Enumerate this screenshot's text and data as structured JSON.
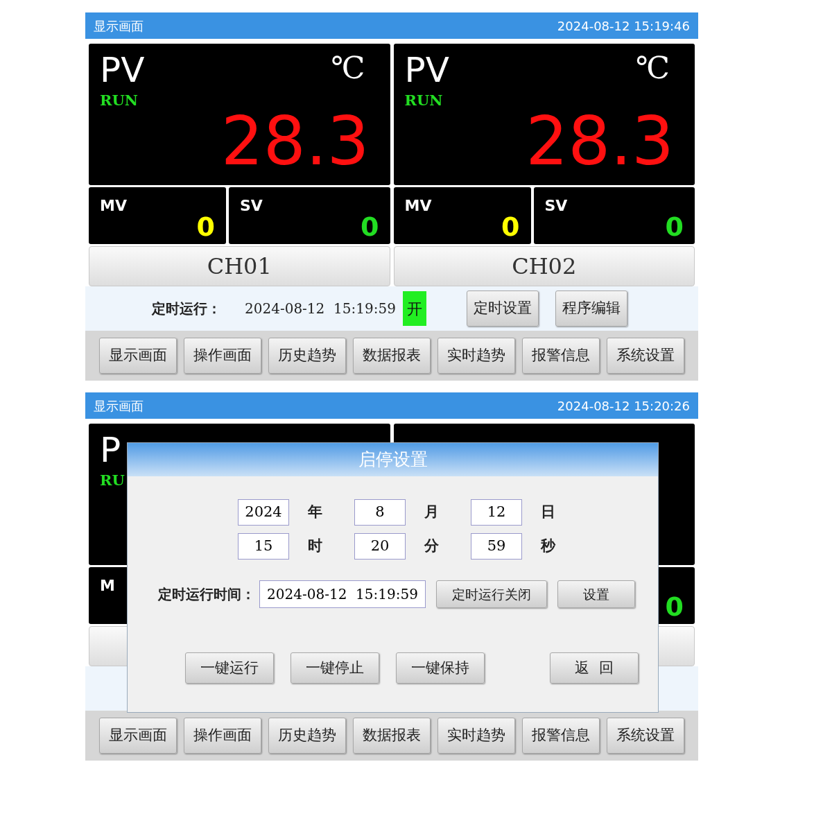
{
  "screens": [
    {
      "header": {
        "title": "显示画面",
        "datetime": "2024-08-12 15:19:46"
      },
      "channels": [
        {
          "pv_label": "PV",
          "unit": "℃",
          "status": "RUN",
          "value": "28.3",
          "mv_label": "MV",
          "mv_value": "0",
          "sv_label": "SV",
          "sv_value": "0",
          "name": "CH01"
        },
        {
          "pv_label": "PV",
          "unit": "℃",
          "status": "RUN",
          "value": "28.3",
          "mv_label": "MV",
          "mv_value": "0",
          "sv_label": "SV",
          "sv_value": "0",
          "name": "CH02"
        }
      ],
      "timer": {
        "label": "定时运行：",
        "time": "2024-08-12  15:19:59",
        "state": "开",
        "on": true,
        "buttons": [
          "定时设置",
          "程序编辑"
        ]
      },
      "nav": [
        "显示画面",
        "操作画面",
        "历史趋势",
        "数据报表",
        "实时趋势",
        "报警信息",
        "系统设置"
      ]
    },
    {
      "header": {
        "title": "显示画面",
        "datetime": "2024-08-12 15:20:26"
      },
      "channels": [
        {
          "pv_label": "P",
          "status": "RU",
          "mv_label": "M"
        },
        {
          "sv_value": "0"
        }
      ],
      "dialog": {
        "title": "启停设置",
        "fields": [
          {
            "value": "2024",
            "unit": "年"
          },
          {
            "value": "8",
            "unit": "月"
          },
          {
            "value": "12",
            "unit": "日"
          },
          {
            "value": "15",
            "unit": "时"
          },
          {
            "value": "20",
            "unit": "分"
          },
          {
            "value": "59",
            "unit": "秒"
          }
        ],
        "timer_label": "定时运行时间：",
        "timer_value": "2024-08-12  15:19:59",
        "timer_buttons": [
          "定时运行关闭",
          "设置"
        ],
        "actions": [
          "一键运行",
          "一键停止",
          "一键保持"
        ],
        "back": "返  回"
      },
      "nav": [
        "显示画面",
        "操作画面",
        "历史趋势",
        "数据报表",
        "实时趋势",
        "报警信息",
        "系统设置"
      ]
    }
  ]
}
